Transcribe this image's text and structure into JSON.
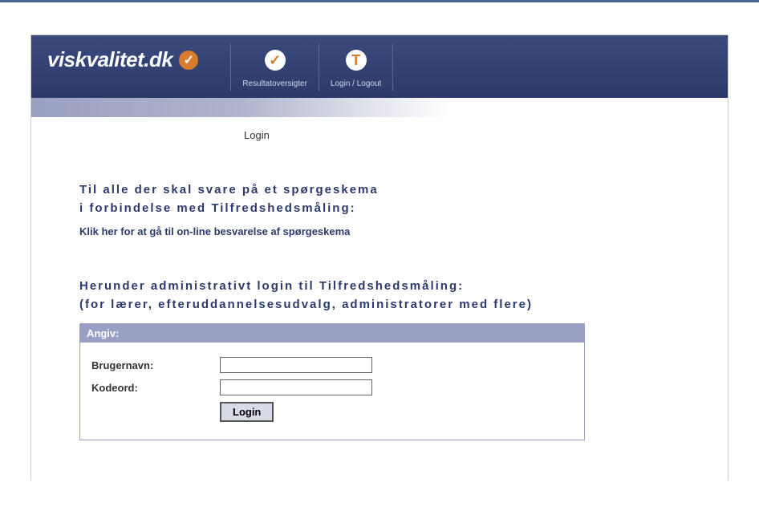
{
  "header": {
    "logo_text": "viskvalitet.dk",
    "nav": [
      {
        "label": "Resultatoversigter",
        "icon_char": "✓",
        "icon_name": "results-icon"
      },
      {
        "label": "Login / Logout",
        "icon_char": "T",
        "icon_name": "login-icon"
      }
    ]
  },
  "breadcrumb": "Login",
  "content": {
    "intro_heading_line1": "Til alle der skal svare på et spørgeskema",
    "intro_heading_line2": "i forbindelse med Tilfredshedsmåling:",
    "intro_link": "Klik her for at gå til on-line besvarelse af spørgeskema",
    "admin_heading_line1": "Herunder administrativt login til Tilfredshedsmåling:",
    "admin_heading_line2": "(for lærer, efteruddannelsesudvalg, administratorer med flere)",
    "login_box_title": "Angiv:",
    "username_label": "Brugernavn:",
    "username_value": "",
    "password_label": "Kodeord:",
    "password_value": "",
    "login_button": "Login"
  }
}
